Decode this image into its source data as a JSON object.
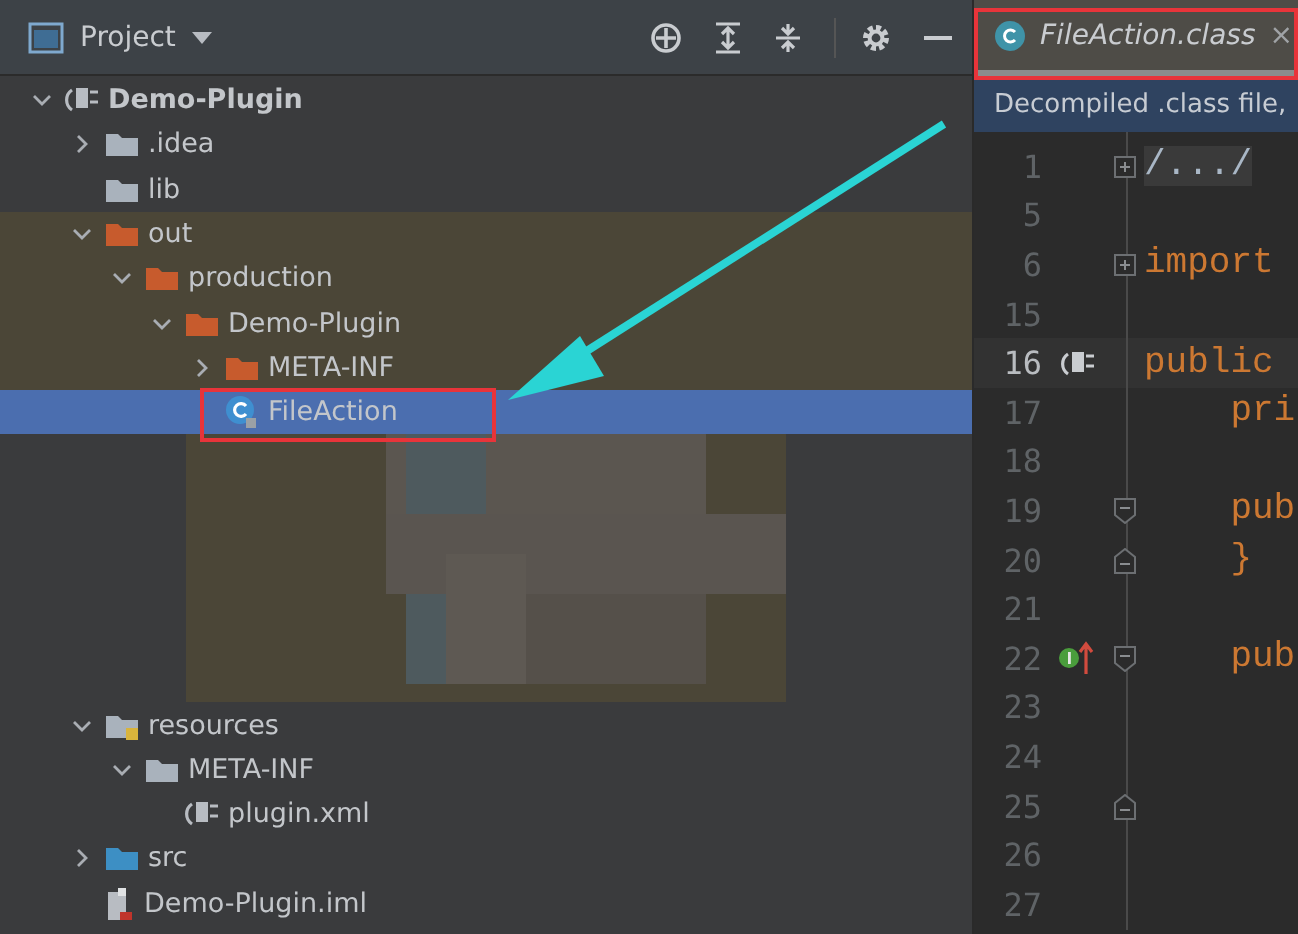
{
  "project_panel": {
    "title": "Project",
    "tree": [
      {
        "label": "Demo-Plugin",
        "kind": "module",
        "bold": true,
        "expanded": true,
        "selected": false,
        "excluded": false,
        "children": [
          {
            "label": ".idea",
            "kind": "folder",
            "expanded": false,
            "selected": false,
            "excluded": false
          },
          {
            "label": "lib",
            "kind": "folder",
            "selected": false,
            "excluded": false
          },
          {
            "label": "out",
            "kind": "outfolder",
            "expanded": true,
            "selected": false,
            "excluded": true,
            "children": [
              {
                "label": "production",
                "kind": "outfolder",
                "expanded": true,
                "selected": false,
                "excluded": true,
                "children": [
                  {
                    "label": "Demo-Plugin",
                    "kind": "outfolder",
                    "expanded": true,
                    "selected": false,
                    "excluded": true,
                    "children": [
                      {
                        "label": "META-INF",
                        "kind": "outfolder",
                        "expanded": false,
                        "selected": false,
                        "excluded": true
                      },
                      {
                        "label": "FileAction",
                        "kind": "class",
                        "selected": true,
                        "excluded": true
                      }
                    ]
                  }
                ]
              }
            ]
          },
          {
            "label": "resources",
            "kind": "resources",
            "expanded": true,
            "selected": false,
            "excluded": false,
            "children": [
              {
                "label": "META-INF",
                "kind": "folder",
                "expanded": true,
                "selected": false,
                "excluded": false,
                "children": [
                  {
                    "label": "plugin.xml",
                    "kind": "plugin",
                    "selected": false,
                    "excluded": false
                  }
                ]
              }
            ]
          },
          {
            "label": "src",
            "kind": "sources",
            "expanded": false,
            "selected": false,
            "excluded": false
          },
          {
            "label": "Demo-Plugin.iml",
            "kind": "iml",
            "selected": false,
            "excluded": false
          }
        ]
      }
    ]
  },
  "editor": {
    "tab": {
      "label": "FileAction.class",
      "close": "×",
      "selected": true
    },
    "banner": "Decompiled .class file,",
    "lines": [
      {
        "number": "1",
        "code": "/.../",
        "fold": {
          "kind": "plus"
        },
        "current": false
      },
      {
        "number": "5",
        "current": false
      },
      {
        "number": "6",
        "code": "import",
        "fold": {
          "kind": "plus"
        },
        "current": false
      },
      {
        "number": "15",
        "current": false
      },
      {
        "number": "16",
        "code": "public",
        "gutter": {
          "kind": "plugin"
        },
        "current": true
      },
      {
        "number": "17",
        "code": "    pri",
        "current": false
      },
      {
        "number": "18",
        "current": false
      },
      {
        "number": "19",
        "code": "    pub",
        "fold": {
          "kind": "start"
        },
        "current": false
      },
      {
        "number": "20",
        "code": "    }",
        "fold": {
          "kind": "end"
        },
        "current": false
      },
      {
        "number": "21",
        "current": false
      },
      {
        "number": "22",
        "code": "    pub",
        "fold": {
          "kind": "start"
        },
        "gutter": {
          "kind": "implements"
        },
        "current": false
      },
      {
        "number": "23",
        "current": false
      },
      {
        "number": "24",
        "current": false
      },
      {
        "number": "25",
        "fold": {
          "kind": "end"
        },
        "current": false
      },
      {
        "number": "26",
        "current": false
      },
      {
        "number": "27",
        "current": false
      }
    ]
  }
}
